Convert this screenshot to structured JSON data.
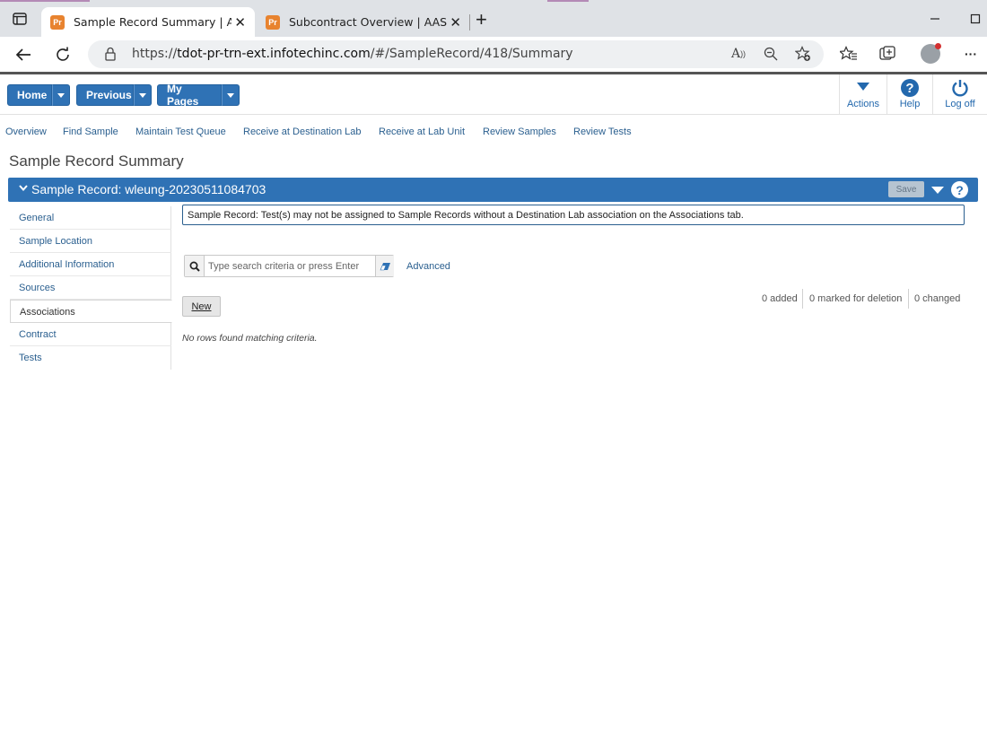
{
  "browser": {
    "tabs": [
      {
        "favicon": "Pr",
        "title": "Sample Record Summary | AASH",
        "active": true
      },
      {
        "favicon": "Pr",
        "title": "Subcontract Overview | AASHTO\\",
        "active": false
      }
    ],
    "url_prefix": "https://",
    "url_host": "tdot-pr-trn-ext.infotechinc.com",
    "url_path": "/#/SampleRecord/418/Summary",
    "reader_label": "A",
    "menu_label": "···"
  },
  "toolbar": {
    "home_label": "Home",
    "previous_label": "Previous",
    "mypages_label": "My Pages",
    "actions_label": "Actions",
    "help_label": "Help",
    "logoff_label": "Log off"
  },
  "subnav": [
    "Overview",
    "Find Sample",
    "Maintain Test Queue",
    "Receive at Destination Lab",
    "Receive at Lab Unit",
    "Review Samples",
    "Review Tests"
  ],
  "page_title": "Sample Record Summary",
  "panel": {
    "title": "Sample Record: wleung-20230511084703",
    "save_label": "Save",
    "help_glyph": "?"
  },
  "side_tabs": [
    "General",
    "Sample Location",
    "Additional Information",
    "Sources",
    "Associations",
    "Contract",
    "Tests"
  ],
  "active_side_tab": "Associations",
  "alert_text": "Sample Record: Test(s) may not be assigned to Sample Records without a Destination Lab association on the Associations tab.",
  "search": {
    "placeholder": "Type search criteria or press Enter"
  },
  "advanced_label": "Advanced",
  "counts": {
    "added": "0 added",
    "deleted": "0 marked for deletion",
    "changed": "0 changed"
  },
  "new_label": "New",
  "empty_message": "No rows found matching criteria."
}
